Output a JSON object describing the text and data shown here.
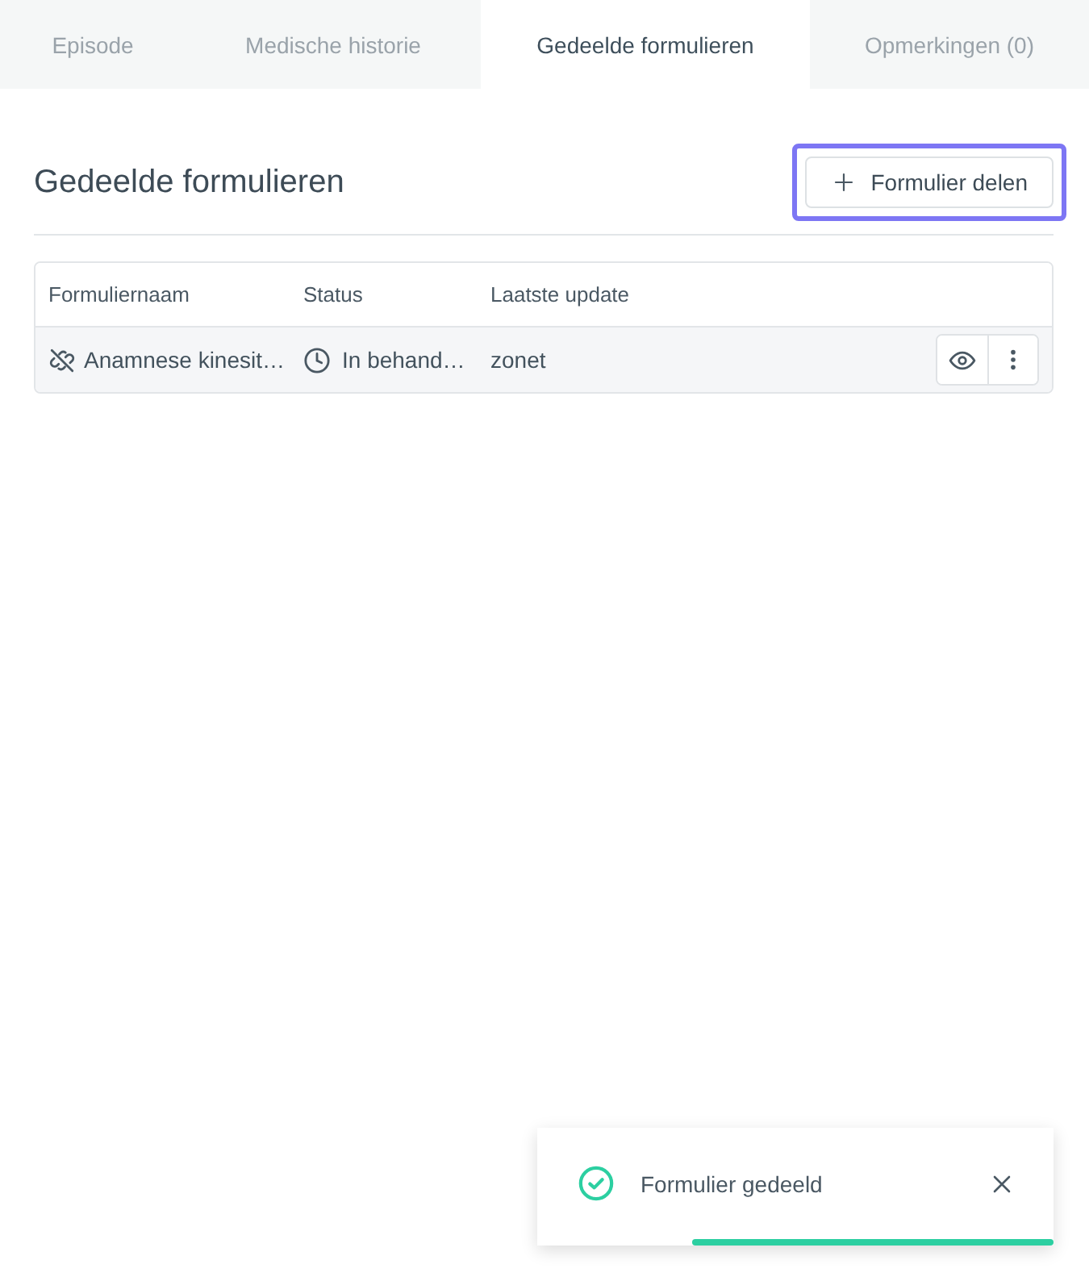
{
  "tabs": [
    {
      "label": "Episode",
      "selected": false
    },
    {
      "label": "Medische historie",
      "selected": false
    },
    {
      "label": "Gedeelde formulieren",
      "selected": true
    },
    {
      "label": "Opmerkingen (0)",
      "selected": false
    }
  ],
  "section": {
    "title": "Gedeelde formulieren",
    "share_button": {
      "label": "Formulier delen",
      "focused": true
    }
  },
  "table": {
    "columns": [
      "Formuliernaam",
      "Status",
      "Laatste update"
    ],
    "rows": [
      {
        "name": "Anamnese kinesit…",
        "status": "In behand…",
        "updated": "zonet"
      }
    ]
  },
  "toast": {
    "message": "Formulier gedeeld",
    "level": 0.7
  }
}
